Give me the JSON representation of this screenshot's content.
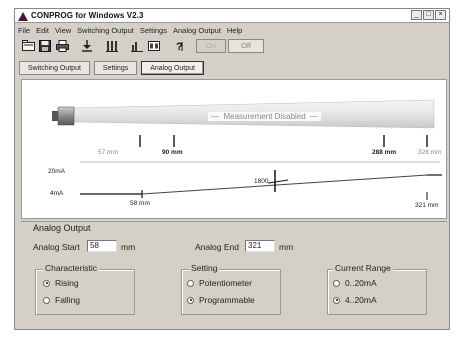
{
  "window": {
    "title": "CONPROG for Windows V2.3",
    "controls": [
      "_",
      "□",
      "×"
    ]
  },
  "menu": [
    "File",
    "Edit",
    "View",
    "Switching Output",
    "Settings",
    "Analog Output",
    "Help"
  ],
  "toolbar": {
    "icons": [
      "open-icon",
      "save-icon",
      "print-icon",
      "download-icon",
      "switch-output-icon",
      "settings-icon",
      "help-icon"
    ],
    "on_label": "On",
    "off_label": "Off"
  },
  "tabs": [
    "Switching Output",
    "Settings",
    "Analog Output"
  ],
  "graphic": {
    "measurement_status": "Measurement Disabled",
    "scale_labels": {
      "min": "57 mm",
      "start": "90 mm",
      "end": "288 mm",
      "max": "328 mm"
    },
    "curve": {
      "high_label": "20mA",
      "low_label": "4mA",
      "start_value": "58 mm",
      "end_value": "321 mm",
      "mid_readout": "1800"
    }
  },
  "analog": {
    "group_title": "Analog Output",
    "start_label": "Analog Start",
    "start_value": "58",
    "end_label": "Analog End",
    "end_value": "321",
    "unit": "mm",
    "characteristic": {
      "title": "Characteristic",
      "options": [
        {
          "label": "Rising",
          "checked": true
        },
        {
          "label": "Falling",
          "checked": false
        }
      ]
    },
    "setting": {
      "title": "Setting",
      "options": [
        {
          "label": "Potentiometer",
          "checked": false
        },
        {
          "label": "Programmable",
          "checked": true
        }
      ]
    },
    "current_range": {
      "title": "Current Range",
      "options": [
        {
          "label": "0..20mA",
          "checked": false
        },
        {
          "label": "4..20mA",
          "checked": true
        }
      ]
    }
  }
}
